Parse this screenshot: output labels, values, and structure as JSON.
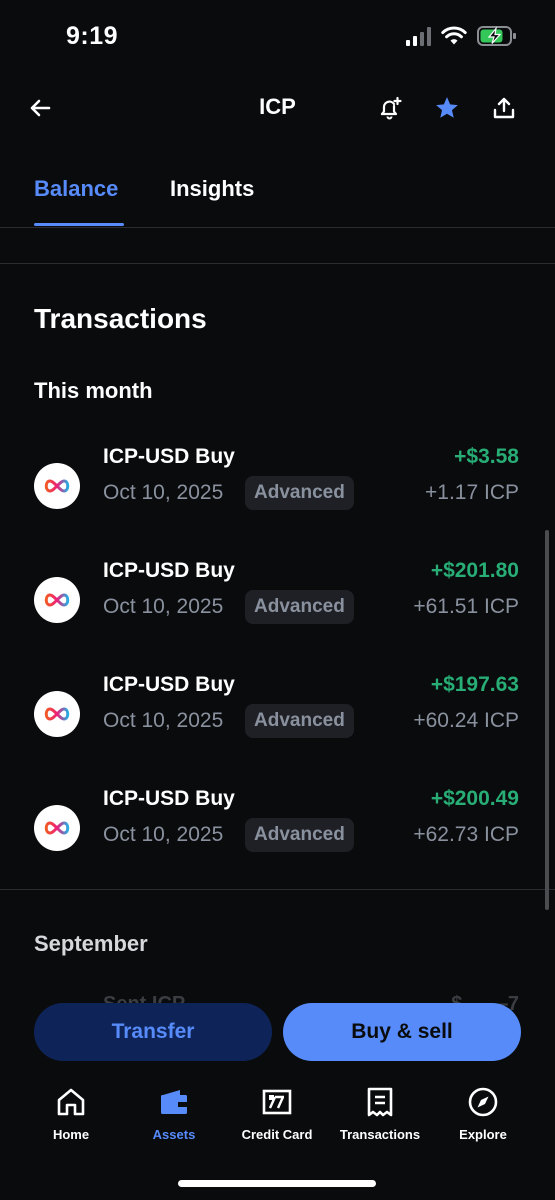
{
  "status_bar": {
    "time": "9:19"
  },
  "header": {
    "title": "ICP"
  },
  "tabs": [
    {
      "label": "Balance",
      "active": true
    },
    {
      "label": "Insights",
      "active": false
    }
  ],
  "transactions": {
    "title": "Transactions",
    "groups": [
      {
        "label": "This month",
        "items": [
          {
            "title": "ICP-USD Buy",
            "date": "Oct 10, 2025",
            "badge": "Advanced",
            "amount": "+$3.58",
            "sub_amount": "+1.17 ICP"
          },
          {
            "title": "ICP-USD Buy",
            "date": "Oct 10, 2025",
            "badge": "Advanced",
            "amount": "+$201.80",
            "sub_amount": "+61.51 ICP"
          },
          {
            "title": "ICP-USD Buy",
            "date": "Oct 10, 2025",
            "badge": "Advanced",
            "amount": "+$197.63",
            "sub_amount": "+60.24 ICP"
          },
          {
            "title": "ICP-USD Buy",
            "date": "Oct 10, 2025",
            "badge": "Advanced",
            "amount": "+$200.49",
            "sub_amount": "+62.73 ICP"
          }
        ]
      },
      {
        "label": "September",
        "items": [
          {
            "title": "Sent ICP",
            "amount": "-$—.—7"
          }
        ]
      }
    ]
  },
  "actions": {
    "transfer_label": "Transfer",
    "buysell_label": "Buy & sell"
  },
  "bottom_nav": [
    {
      "label": "Home",
      "icon": "home-icon",
      "active": false
    },
    {
      "label": "Assets",
      "icon": "wallet-icon",
      "active": true
    },
    {
      "label": "Credit Card",
      "icon": "credit-card-icon",
      "active": false
    },
    {
      "label": "Transactions",
      "icon": "receipt-icon",
      "active": false
    },
    {
      "label": "Explore",
      "icon": "compass-icon",
      "active": false
    }
  ],
  "colors": {
    "background": "#0a0b0d",
    "accent": "#578bfa",
    "positive": "#27ad75",
    "muted": "#8a919e",
    "transfer_bg": "#0e2459"
  }
}
